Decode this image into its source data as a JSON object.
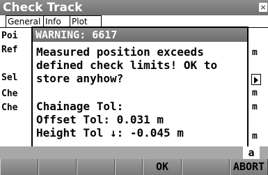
{
  "window": {
    "title": "Check Track",
    "close_symbol": "×"
  },
  "tabs": [
    {
      "label": "General"
    },
    {
      "label": "Info"
    },
    {
      "label": "Plot"
    }
  ],
  "background_fields": {
    "left_labels": [
      "Poi",
      "Ref",
      "Sel",
      "Che",
      "Che"
    ],
    "right_marks": [
      "m",
      "m",
      "m",
      "m"
    ]
  },
  "dialog": {
    "title": "WARNING: 6617",
    "lines": [
      "Measured position exceeds",
      "defined check limits! OK to",
      "store anyhow?",
      "Chainage Tol:",
      "Offset Tol: 0.031 m",
      "Height Tol ↓: -0.045 m"
    ]
  },
  "status": {
    "text": "a"
  },
  "softkeys": [
    "",
    "",
    "",
    "",
    "OK",
    "",
    "ABORT"
  ]
}
